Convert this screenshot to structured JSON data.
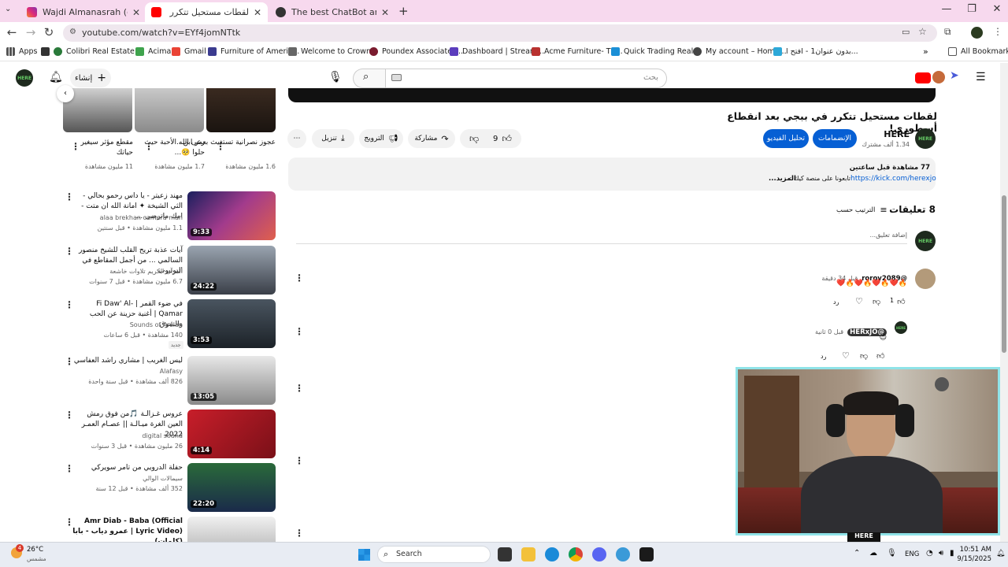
{
  "browser": {
    "tabs": [
      {
        "title": "Wajdi Almanasrah (@wajdi_ma",
        "icon": "instagram-icon"
      },
      {
        "title": "لقطات مستحيل تتكرر في ببجي ب",
        "icon": "youtube-icon",
        "active": true
      },
      {
        "title": "The best ChatBot and Widgets",
        "icon": "chatbot-icon"
      }
    ],
    "url": "youtube.com/watch?v=EYf4jomNTtk",
    "bookmarks": [
      "Apps",
      "Colibri Real Estate",
      "Acima",
      "Gmail",
      "Furniture of Americ...",
      "Welcome to Crown...",
      "Poundex Associates...",
      "Dashboard | Stream...",
      "Acme Furniture- Th...",
      "Quick Trading Real...",
      "My account – Home...",
      "بدون عنوان1 - افتح ا..."
    ],
    "all_bookmarks": "All Bookmarks"
  },
  "header": {
    "search_placeholder": "بحث",
    "create_label": "إنشاء"
  },
  "video": {
    "title": "لقطات مستحيل تتكرر في ببجي بعد انقطاع أسطوري!",
    "channel": "HERE",
    "subscribers": "1.34 ألف مشترك",
    "join_label": "الإنضمامات",
    "subscribe_label": "تحليل الفيديو",
    "likes": "9",
    "share_label": "مشاركة",
    "promote_label": "الترويج",
    "download_label": "تنزيل",
    "views_line": "77 مشاهدة  قبل ساعتين",
    "kick_url": "https://kick.com/herexjo",
    "desc_line": "تابعونا على منصة كيك :",
    "more_label": "...المزيد"
  },
  "comments": {
    "count_label": "8 تعليقات",
    "sort_label": "الترتيب حسب",
    "add_placeholder": "إضافة تعليق...",
    "items": [
      {
        "author": "@roroy2089",
        "time": "قبل 34 دقيقة",
        "text": "🔥❤️🔥❤️🔥❤️🔥❤️",
        "likes": "1",
        "reply": "رد"
      },
      {
        "author": "@HERxJO",
        "time": "قبل 0 ثانية",
        "text": "😍",
        "likes": "",
        "reply": "رد"
      }
    ]
  },
  "shorts": [
    {
      "title": "عجوز نصرانية تستغيث بعمر ابن...",
      "views": "1.6 مليون مشاهدة"
    },
    {
      "title": "رعى الله الأحبة حيث حلوا 🥺...",
      "views": "1.7 مليون مشاهدة"
    },
    {
      "title": "مقطع مؤثر سيغير حياتك",
      "views": "11 مليون مشاهدة"
    }
  ],
  "related": [
    {
      "title": "مهند زعيتر - يا داس رحمو بحالي - الثي الشيخة ✦ امانة الله ان متت - امك ماترضى ...",
      "channel": "alaa brekhan camera man",
      "meta": "1.1 مليون مشاهدة • قبل سنتين",
      "duration": "9:33"
    },
    {
      "title": "آيات عذبة تريح القلب للشيخ منصور السالمي ... من أجمل المقاطع في اليوتيوب",
      "channel": "القرآن الكريم تلاوات خاشعة",
      "meta": "6.7 مليون مشاهدة • قبل 7 سنوات",
      "duration": "24:22"
    },
    {
      "title": "في ضوء القمر | Fi Daw' Al-Qamar | أغنية حزينة عن الحب والشوق",
      "channel": "Sounds of Arsian",
      "meta": "140 مشاهدة • قبل 6 ساعات",
      "duration": "3:53",
      "badge": "جديد"
    },
    {
      "title": "ليس الغريب | مشاري راشد العفاسي",
      "channel": "Alafasy",
      "meta": "826 ألف مشاهدة • قبل سنة واحدة",
      "duration": "13:05"
    },
    {
      "title": "عروس غـزالـة 🎵من فوق رمش العين الغرة ميـالـة || عصـام العمـر 2022",
      "channel": "digital sound",
      "meta": "26 مليون مشاهدة • قبل 3 سنوات",
      "duration": "4:14"
    },
    {
      "title": "حفلة الدرويي من تامر سويركي",
      "channel": "سيمالات الوالي",
      "meta": "352 ألف مشاهدة • قبل 12 سنة",
      "duration": "22:20"
    },
    {
      "title": "Amr Diab - Baba (Official Lyric Video) | عمرو دياب - بابا (كلمات)",
      "channel": "",
      "meta": "",
      "duration": ""
    }
  ],
  "taskbar": {
    "weather_temp": "26°C",
    "weather_desc": "مشمس",
    "search_label": "Search",
    "lang": "ENG",
    "time": "10:51 AM",
    "date": "9/15/2025",
    "notif_badge": "4"
  },
  "colors": {
    "youtube_red": "#ff0000",
    "subscribe_blue": "#065fd4",
    "tabstrip_pink": "#f7d9ee"
  }
}
